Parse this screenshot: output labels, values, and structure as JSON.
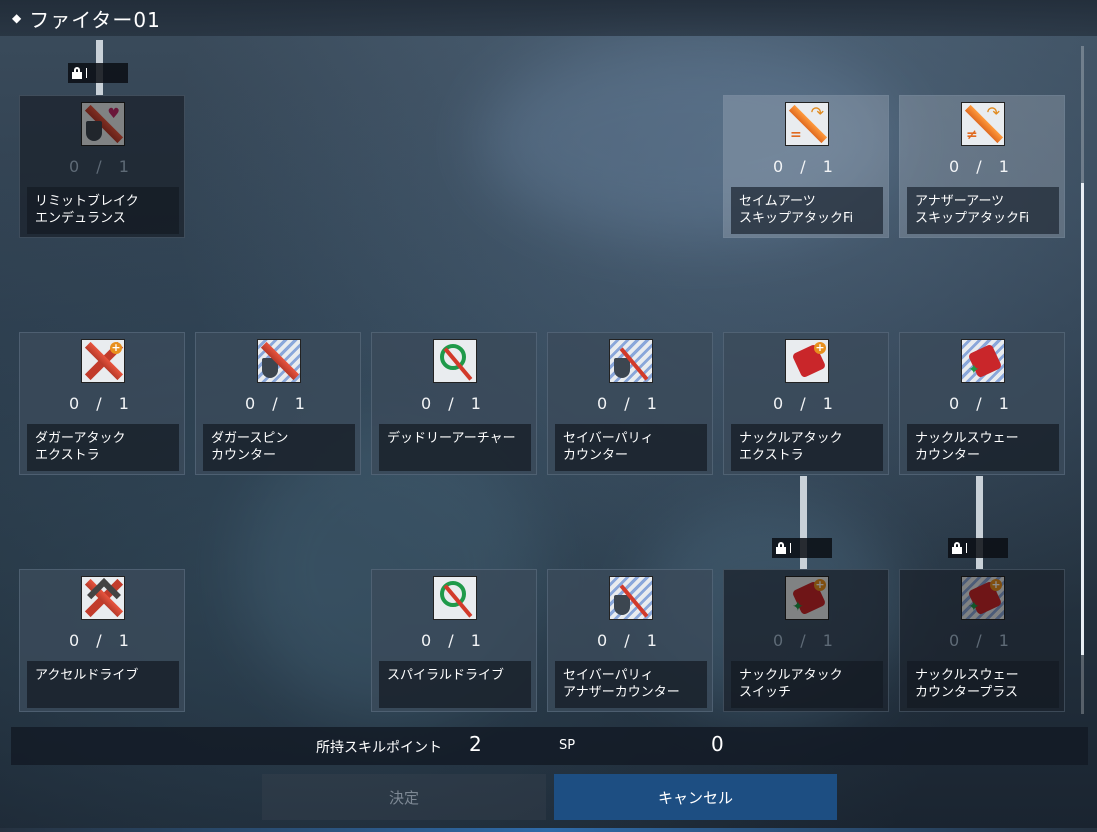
{
  "header": {
    "title": "ファイター01"
  },
  "cards": [
    {
      "count": "0 / 1",
      "name1": "リミットブレイク",
      "name2": "エンデュランス"
    },
    {
      "count": "0 / 1",
      "name1": "セイムアーツ",
      "name2": "スキップアタックFi"
    },
    {
      "count": "0 / 1",
      "name1": "アナザーアーツ",
      "name2": "スキップアタックFi"
    },
    {
      "count": "0 / 1",
      "name1": "ダガーアタック",
      "name2": "エクストラ"
    },
    {
      "count": "0 / 1",
      "name1": "ダガースピン",
      "name2": "カウンター"
    },
    {
      "count": "0 / 1",
      "name1": "デッドリーアーチャー",
      "name2": ""
    },
    {
      "count": "0 / 1",
      "name1": "セイバーパリィ",
      "name2": "カウンター"
    },
    {
      "count": "0 / 1",
      "name1": "ナックルアタック",
      "name2": "エクストラ"
    },
    {
      "count": "0 / 1",
      "name1": "ナックルスウェー",
      "name2": "カウンター"
    },
    {
      "count": "0 / 1",
      "name1": "アクセルドライブ",
      "name2": ""
    },
    {
      "count": "0 / 1",
      "name1": "スパイラルドライブ",
      "name2": ""
    },
    {
      "count": "0 / 1",
      "name1": "セイバーパリィ",
      "name2": "アナザーカウンター"
    },
    {
      "count": "0 / 1",
      "name1": "ナックルアタック",
      "name2": "スイッチ"
    },
    {
      "count": "0 / 1",
      "name1": "ナックルスウェー",
      "name2": "カウンタープラス"
    }
  ],
  "sp_bar": {
    "label": "所持スキルポイント",
    "value": "2",
    "unit": "SP",
    "sp_value": "0"
  },
  "buttons": {
    "confirm": "決定",
    "cancel": "キャンセル"
  }
}
